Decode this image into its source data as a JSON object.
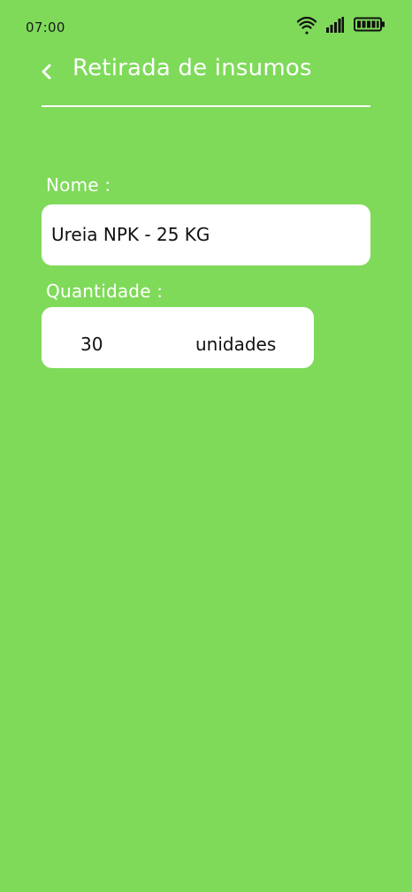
{
  "status_bar": {
    "time": "07:00",
    "icons": [
      "wifi-icon",
      "cellular-signal-icon",
      "battery-icon"
    ]
  },
  "header": {
    "title": "Retirada de insumos",
    "back_icon": "chevron-left-icon"
  },
  "form": {
    "name_label": "Nome :",
    "name_value": "Ureia NPK - 25 KG",
    "quantity_label": "Quantidade :",
    "quantity_value": "30",
    "quantity_unit": "unidades"
  },
  "colors": {
    "background": "#7FDA5A",
    "text_light": "#FFFFFF",
    "input_background": "#FFFFFF",
    "text_dark": "#111111"
  }
}
